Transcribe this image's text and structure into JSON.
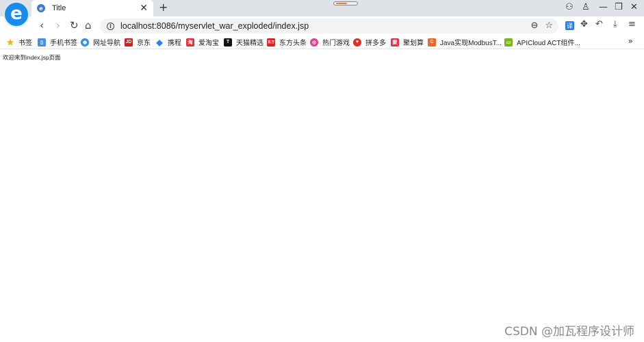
{
  "tab": {
    "title": "Title"
  },
  "address": {
    "url": "localhost:8086/myservlet_war_exploded/index.jsp"
  },
  "bookmarks": [
    {
      "label": "书签",
      "color": "#f5b400",
      "icon": "star-icon",
      "glyph": "★"
    },
    {
      "label": "手机书签",
      "color": "#4a90e2",
      "icon": "phone-bookmark-icon",
      "glyph": "▯"
    },
    {
      "label": "网址导航",
      "color": "#2f8ee8",
      "icon": "nav-icon",
      "glyph": "◉"
    },
    {
      "label": "京东",
      "color": "#d71c1c",
      "icon": "jd-icon",
      "glyph": "JD"
    },
    {
      "label": "携程",
      "color": "#2d7ff9",
      "icon": "ctrip-icon",
      "glyph": "◆"
    },
    {
      "label": "爱淘宝",
      "color": "#e8303a",
      "icon": "taobao-icon",
      "glyph": "淘"
    },
    {
      "label": "天猫精选",
      "color": "#c8102e",
      "icon": "tmall-icon",
      "glyph": "T"
    },
    {
      "label": "东方头条",
      "color": "#e02020",
      "icon": "toutiao-icon",
      "glyph": "东方"
    },
    {
      "label": "热门游戏",
      "color": "#e83b8c",
      "icon": "game-icon",
      "glyph": "◎"
    },
    {
      "label": "拼多多",
      "color": "#e02e24",
      "icon": "pdd-icon",
      "glyph": "♥"
    },
    {
      "label": "聚划算",
      "color": "#e8334a",
      "icon": "juhuasuan-icon",
      "glyph": "聚"
    },
    {
      "label": "Java实现ModbusT...",
      "color": "#f26522",
      "icon": "csdn-icon",
      "glyph": "C"
    },
    {
      "label": "APICloud ACT组件...",
      "color": "#7cb518",
      "icon": "apicloud-icon",
      "glyph": "▭"
    }
  ],
  "page": {
    "text": "欢迎来到index.jsp页面"
  },
  "watermark": "CSDN @加瓦程序设计师"
}
